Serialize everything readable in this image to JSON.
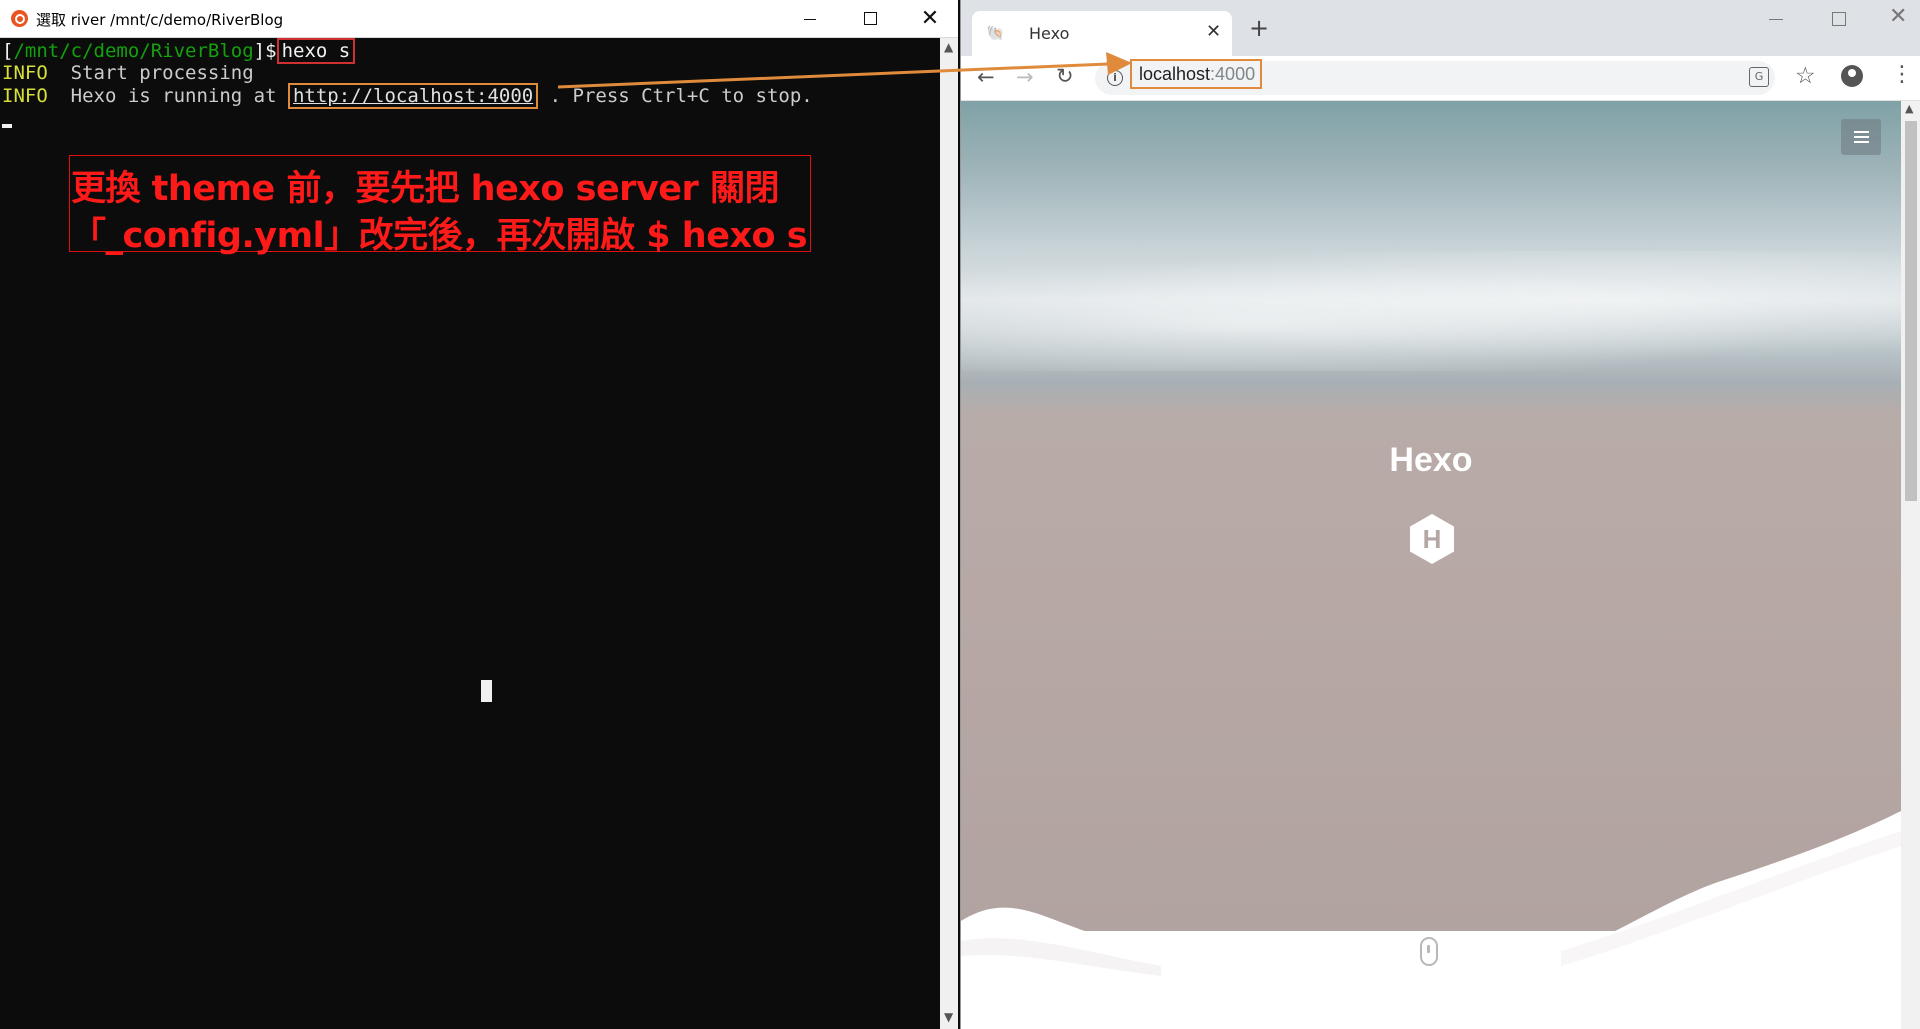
{
  "terminal": {
    "title": "選取 river /mnt/c/demo/RiverBlog",
    "prompt_open": "[",
    "prompt_path": "/mnt/c/demo/RiverBlog",
    "prompt_close": "]$",
    "command": "hexo s",
    "lines": [
      {
        "level": "INFO",
        "text": "  Start processing"
      },
      {
        "level": "INFO",
        "prefix": "  Hexo is running at ",
        "url": "http://localhost:4000",
        "suffix": " . Press Ctrl+C to stop."
      }
    ]
  },
  "annotation": {
    "line1": "更換 theme 前，要先把 hexo server 關閉",
    "line2": "「_config.yml」改完後，再次開啟 $ hexo s",
    "color": "#ff1a1a"
  },
  "browser": {
    "tab_title": "Hexo",
    "url_host": "localhost",
    "url_port": ":4000",
    "page": {
      "site_title": "Hexo",
      "logo_letter": "H"
    }
  },
  "colors": {
    "terminal_bg": "#0c0c0c",
    "prompt_green": "#13a10e",
    "info_yellow": "#d6e038",
    "highlight_orange": "#e08a3c",
    "highlight_red": "#d03030"
  }
}
